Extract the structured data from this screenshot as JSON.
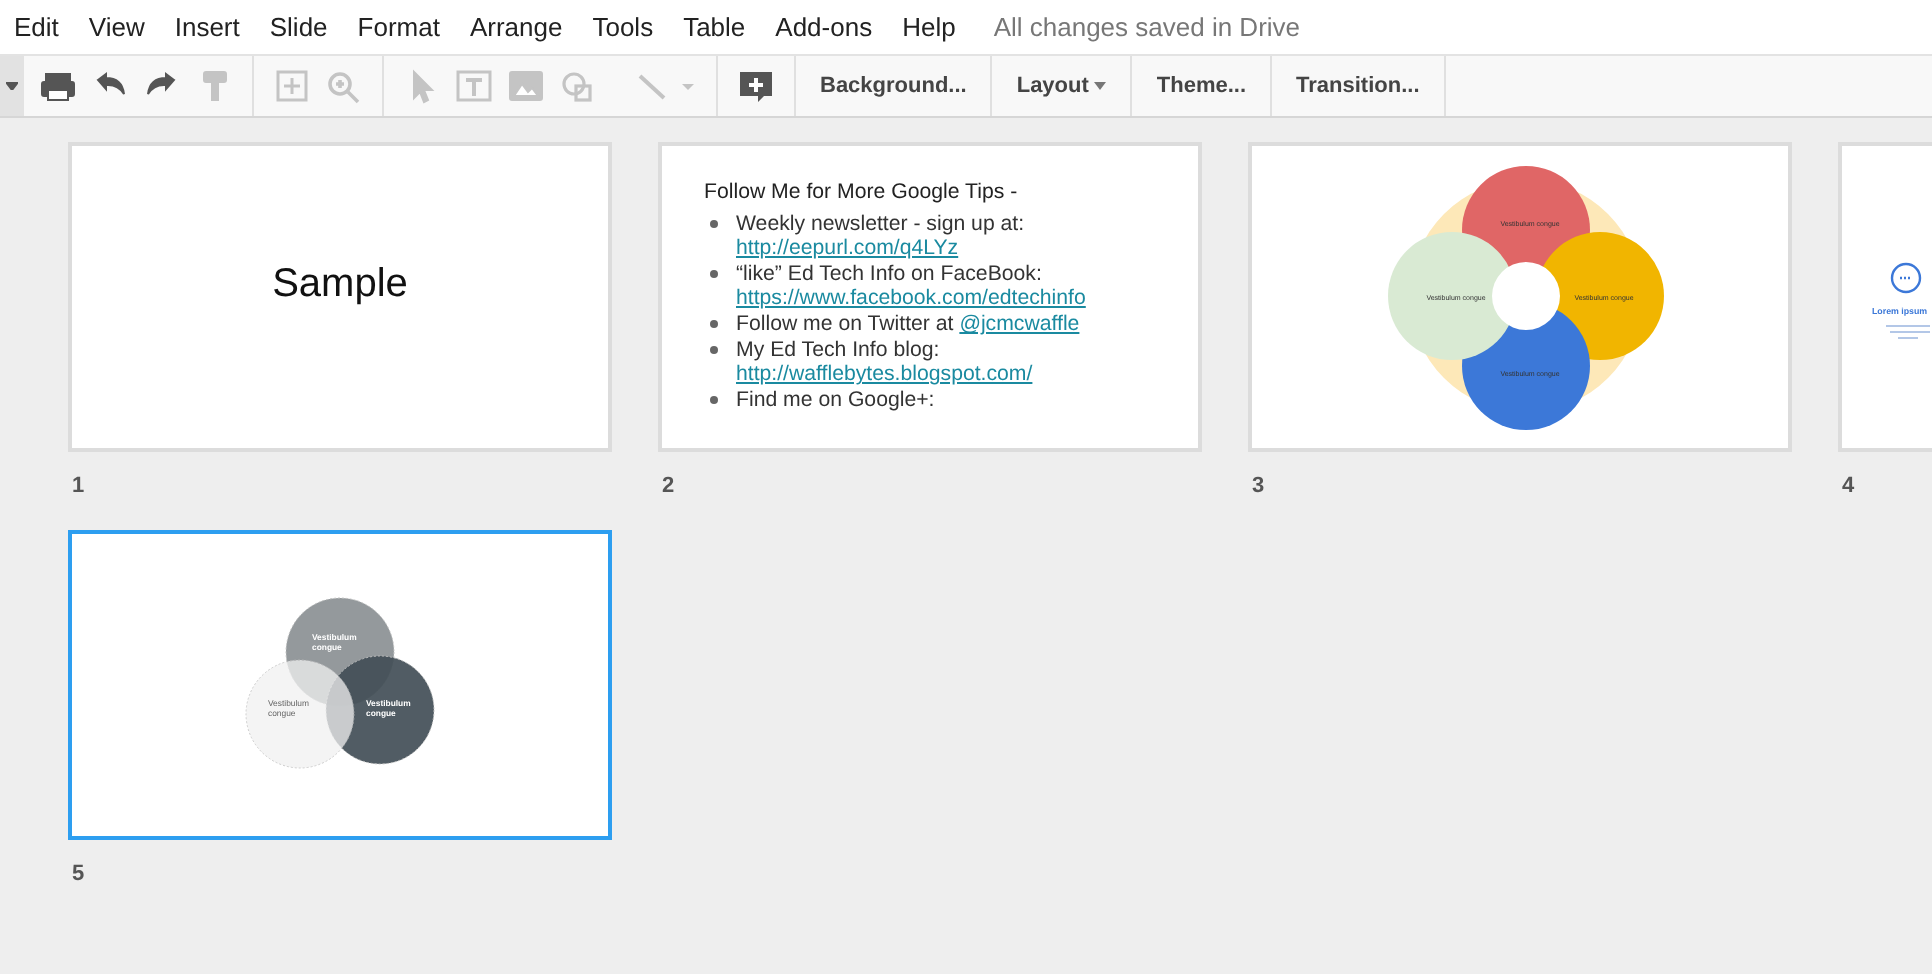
{
  "menu": [
    "Edit",
    "View",
    "Insert",
    "Slide",
    "Format",
    "Arrange",
    "Tools",
    "Table",
    "Add-ons",
    "Help"
  ],
  "save_status": "All changes saved in Drive",
  "tools": [
    {
      "kind": "caret",
      "disabled": false
    },
    {
      "kind": "print",
      "disabled": false
    },
    {
      "kind": "undo",
      "disabled": false
    },
    {
      "kind": "redo",
      "disabled": false
    },
    {
      "kind": "paint",
      "disabled": true
    },
    {
      "kind": "sep"
    },
    {
      "kind": "fit",
      "disabled": true
    },
    {
      "kind": "zoom",
      "disabled": true
    },
    {
      "kind": "sep"
    },
    {
      "kind": "select",
      "disabled": true
    },
    {
      "kind": "textbox",
      "disabled": true
    },
    {
      "kind": "image",
      "disabled": true
    },
    {
      "kind": "shape",
      "disabled": true
    },
    {
      "kind": "line",
      "disabled": true
    },
    {
      "kind": "sep"
    },
    {
      "kind": "comment",
      "disabled": false
    },
    {
      "kind": "sep"
    }
  ],
  "toolbar_buttons": [
    {
      "label": "Background...",
      "dropdown": false
    },
    {
      "label": "Layout",
      "dropdown": true
    },
    {
      "label": "Theme...",
      "dropdown": false
    },
    {
      "label": "Transition...",
      "dropdown": false
    }
  ],
  "slides": [
    {
      "number": "1",
      "kind": "title",
      "selected": false,
      "title": "Sample"
    },
    {
      "number": "2",
      "kind": "list",
      "selected": false,
      "heading": "Follow Me for More Google Tips -",
      "bullets": [
        {
          "text": "Weekly newsletter - sign up at:",
          "link": "http://eepurl.com/q4LYz"
        },
        {
          "text": "“like” Ed Tech Info on FaceBook:",
          "link": "https://www.facebook.com/edtechinfo"
        },
        {
          "text": "Follow me on Twitter at",
          "inline_link": "@jcmcwaffle"
        },
        {
          "text": "My Ed Tech Info blog:",
          "link": "http://wafflebytes.blogspot.com/"
        },
        {
          "text": "Find me on Google+:"
        }
      ]
    },
    {
      "number": "3",
      "kind": "flower",
      "selected": false,
      "labels": [
        "Vestibulum congue",
        "Vestibulum congue",
        "Vestibulum congue",
        "Vestibulum congue"
      ]
    },
    {
      "number": "4",
      "kind": "icon",
      "selected": false,
      "title": "Lorem ipsum"
    },
    {
      "number": "5",
      "kind": "venn",
      "selected": true,
      "labels": [
        "Vestibulum congue",
        "Vestibulum congue",
        "Vestibulum congue"
      ]
    }
  ]
}
